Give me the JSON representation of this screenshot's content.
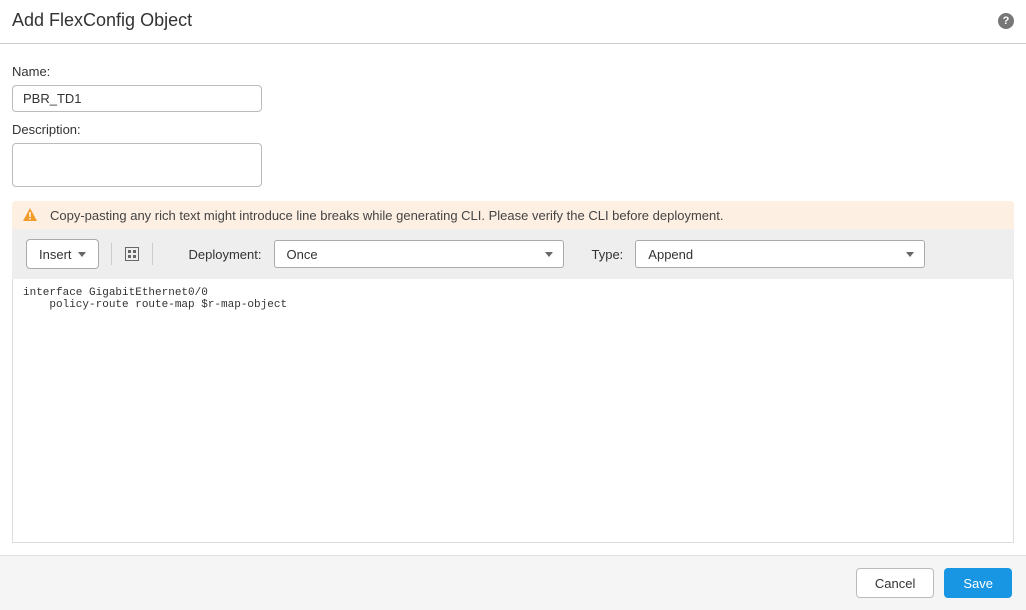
{
  "header": {
    "title": "Add FlexConfig Object"
  },
  "fields": {
    "name_label": "Name:",
    "name_value": "PBR_TD1",
    "description_label": "Description:",
    "description_value": ""
  },
  "warning": {
    "text": "Copy-pasting any rich text might introduce line breaks while generating CLI. Please verify the CLI before deployment."
  },
  "toolbar": {
    "insert_label": "Insert",
    "deployment_label": "Deployment:",
    "deployment_value": "Once",
    "type_label": "Type:",
    "type_value": "Append"
  },
  "code": "interface GigabitEthernet0/0\n    policy-route route-map $r-map-object",
  "footer": {
    "cancel": "Cancel",
    "save": "Save"
  }
}
